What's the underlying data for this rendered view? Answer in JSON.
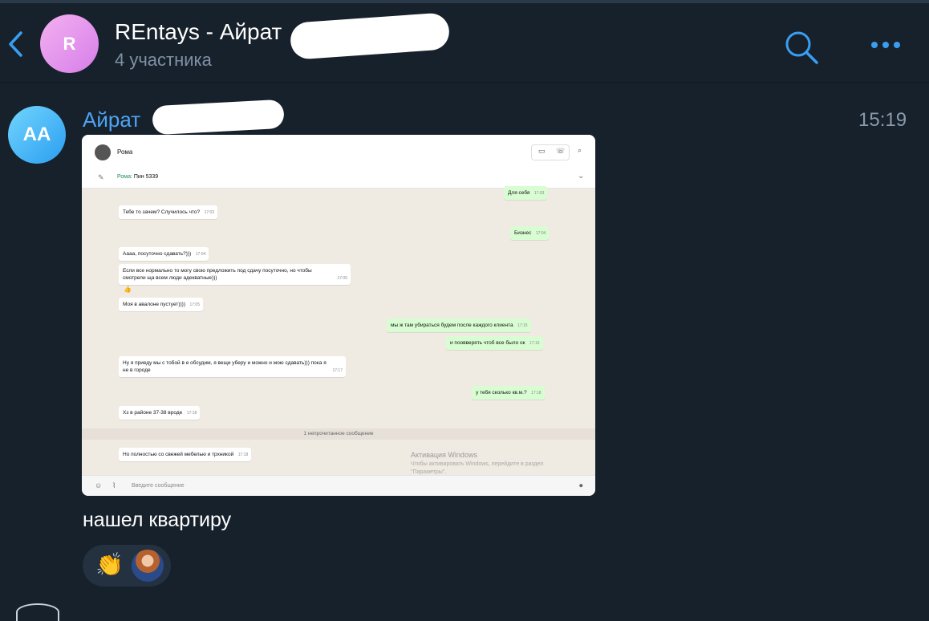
{
  "header": {
    "title": "REntays - Айрат",
    "subtitle": "4 участника",
    "avatar_letter": "R"
  },
  "message": {
    "sender_initials": "AA",
    "sender_name": "Айрат",
    "time": "15:19",
    "text": "нашел квартиру",
    "reaction_emoji": "👏"
  },
  "screenshot": {
    "contact": "Рома",
    "pinned_author": "Рома:",
    "pinned_text": "Пин 5339",
    "messages": [
      {
        "dir": "out",
        "text": "Для себя",
        "time": "17:03"
      },
      {
        "dir": "in",
        "text": "Тебе то зачем? Случилось что?",
        "time": "17:03"
      },
      {
        "dir": "out",
        "text": "Бизнес",
        "time": "17:04"
      },
      {
        "dir": "in",
        "text": "Аааа, посуточно сдавать?)))",
        "time": "17:04"
      },
      {
        "dir": "in",
        "text": "Если все нормально то могу свою предложить под сдачу посуточно, но чтобы смотрели ща всем люди адекватные)))",
        "time": "17:05"
      },
      {
        "dir": "in",
        "text": "👍",
        "time": ""
      },
      {
        "dir": "in",
        "text": "Моя в авалоне пустует))))",
        "time": "17:05"
      },
      {
        "dir": "out",
        "text": "мы ж там убираться будем после каждого клиента",
        "time": "17:15"
      },
      {
        "dir": "out",
        "text": "и поовверять чтоб все было ок",
        "time": "17:16"
      },
      {
        "dir": "in",
        "text": "Ну я приеду мы с тобой в е обсудим, я вещи уберу и можно и мою сдавать))) пока я не в городе",
        "time": "17:17"
      },
      {
        "dir": "out",
        "text": "у тебя сколько кв.м.?",
        "time": "17:18"
      },
      {
        "dir": "in",
        "text": "Хз в районе 37-38 вроде",
        "time": "17:18"
      },
      {
        "dir": "in",
        "text": "Но полностью со свежей мебелью и трхникой",
        "time": "17:18"
      }
    ],
    "unread_divider": "1 непрочитанное сообщение",
    "watermark_title": "Активация Windows",
    "watermark_text": "Чтобы активировать Windows, перейдите в раздел \"Параметры\".",
    "input_placeholder": "Введите сообщение"
  },
  "icons": {
    "back": "chevron-left-icon",
    "search": "search-icon",
    "more": "more-dots-icon"
  },
  "colors": {
    "background": "#17212b",
    "accent": "#4ea4f5",
    "subtitle": "#7f91a4"
  }
}
